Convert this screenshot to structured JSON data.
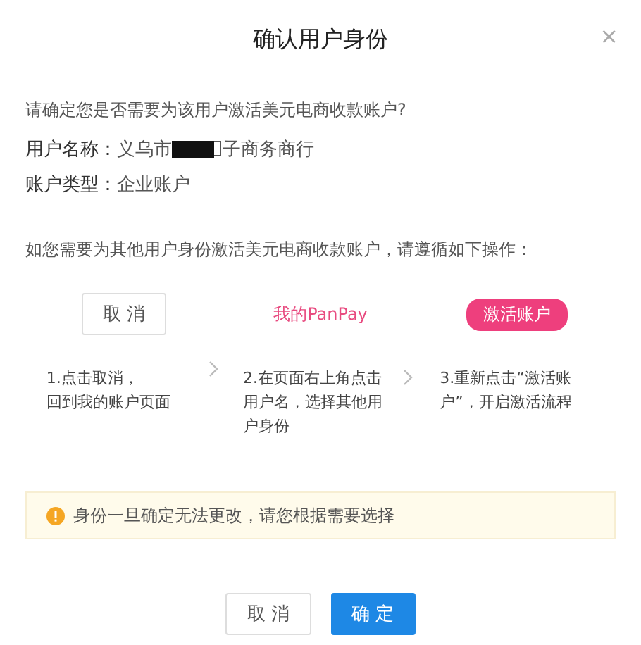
{
  "dialog": {
    "title": "确认用户身份",
    "close": "×"
  },
  "question": "请确定您是否需要为该用户激活美元电商收款账户?",
  "fields": [
    {
      "label": "用户名称：",
      "value": [
        {
          "kind": "text",
          "text": "义乌市"
        },
        {
          "kind": "redaction"
        },
        {
          "kind": "text",
          "text": "子商务商行"
        }
      ]
    },
    {
      "label": "账户类型：",
      "value": [
        {
          "kind": "text",
          "text": "企业账户"
        }
      ]
    }
  ],
  "instruction": "如您需要为其他用户身份激活美元电商收款账户，请遵循如下操作：",
  "steps": [
    {
      "kind": "button",
      "control": "取 消",
      "lines": [
        "1.点击取消，",
        "回到我的账户页面"
      ]
    },
    {
      "kind": "link",
      "control": "我的PanPay",
      "lines": [
        "2.在页面右上角点击",
        "用户名，选择其他用",
        "户身份"
      ]
    },
    {
      "kind": "pill",
      "control": "激活账户",
      "lines": [
        "3.重新点击“激活账",
        "户”，开启激活流程"
      ]
    }
  ],
  "notice": "身份一旦确定无法更改，请您根据需要选择",
  "buttons": [
    {
      "label": "取 消",
      "primary": false
    },
    {
      "label": "确 定",
      "primary": true
    }
  ]
}
